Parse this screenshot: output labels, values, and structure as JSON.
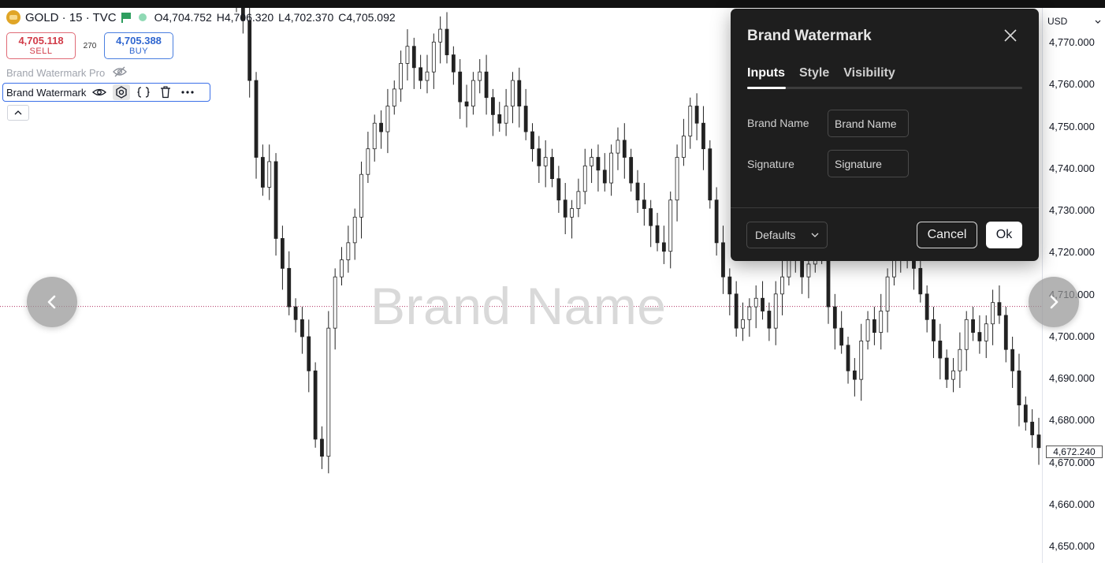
{
  "legend": {
    "symbol": "GOLD · 15 · TVC",
    "open": "O4,704.752",
    "high": "H4,706.320",
    "low": "L4,702.370",
    "close": "C4,705.092"
  },
  "trade": {
    "sell_price": "4,705.118",
    "sell_label": "SELL",
    "spread": "270",
    "buy_price": "4,705.388",
    "buy_label": "BUY"
  },
  "indicators": {
    "pro_name": "Brand Watermark Pro",
    "active_name": "Brand Watermark"
  },
  "watermark_text": "Brand Name",
  "price_axis": {
    "currency": "USD",
    "labels": [
      "4,770.000",
      "4,760.000",
      "4,750.000",
      "4,740.000",
      "4,730.000",
      "4,720.000",
      "4,710.000",
      "4,700.000",
      "4,690.000",
      "4,680.000",
      "4,670.000",
      "4,660.000",
      "4,650.000"
    ],
    "last_price": "4,672.240"
  },
  "dialog": {
    "title": "Brand Watermark",
    "tabs": [
      "Inputs",
      "Style",
      "Visibility"
    ],
    "active_tab": "Inputs",
    "fields": [
      {
        "label": "Brand Name",
        "value": "Brand Name"
      },
      {
        "label": "Signature",
        "value": "Signature"
      }
    ],
    "defaults_label": "Defaults",
    "cancel_label": "Cancel",
    "ok_label": "Ok"
  },
  "colors": {
    "sell": "#d13b48",
    "buy": "#2f66d0",
    "dialog_bg": "#1e1e1e",
    "candle": "#222222",
    "accent_border": "#3b70e8"
  },
  "chart_data": {
    "type": "candlestick",
    "ylim": [
      4645,
      4775
    ],
    "series": [
      {
        "values": [
          4776,
          4772,
          4758,
          4740,
          4733,
          4739,
          4721,
          4714,
          4705,
          4702,
          4698,
          4690,
          4674,
          4670,
          4700,
          4712,
          4716,
          4720,
          4726,
          4736,
          4742,
          4748,
          4746,
          4752,
          4756,
          4762,
          4766,
          4761,
          4758,
          4760,
          4767,
          4770,
          4764,
          4760,
          4753,
          4752,
          4758,
          4760,
          4754,
          4750,
          4748,
          4752,
          4758,
          4752,
          4746,
          4742,
          4738,
          4740,
          4735,
          4730,
          4726,
          4728,
          4732,
          4738,
          4740,
          4737,
          4734,
          4741,
          4744,
          4740,
          4734,
          4730,
          4728,
          4724,
          4720,
          4718,
          4730,
          4740,
          4745,
          4752,
          4748,
          4742,
          4730,
          4720,
          4712,
          4708,
          4700,
          4702,
          4705,
          4707,
          4704,
          4700,
          4708,
          4712,
          4720,
          4716,
          4712,
          4715,
          4720,
          4718,
          4705,
          4700,
          4696,
          4690,
          4688,
          4697,
          4702,
          4699,
          4704,
          4712,
          4716,
          4720,
          4718,
          4714,
          4708,
          4702,
          4697,
          4693,
          4688,
          4690,
          4695,
          4702,
          4699,
          4697,
          4701,
          4706,
          4703,
          4695,
          4690,
          4682,
          4678,
          4675,
          4672
        ]
      }
    ]
  }
}
